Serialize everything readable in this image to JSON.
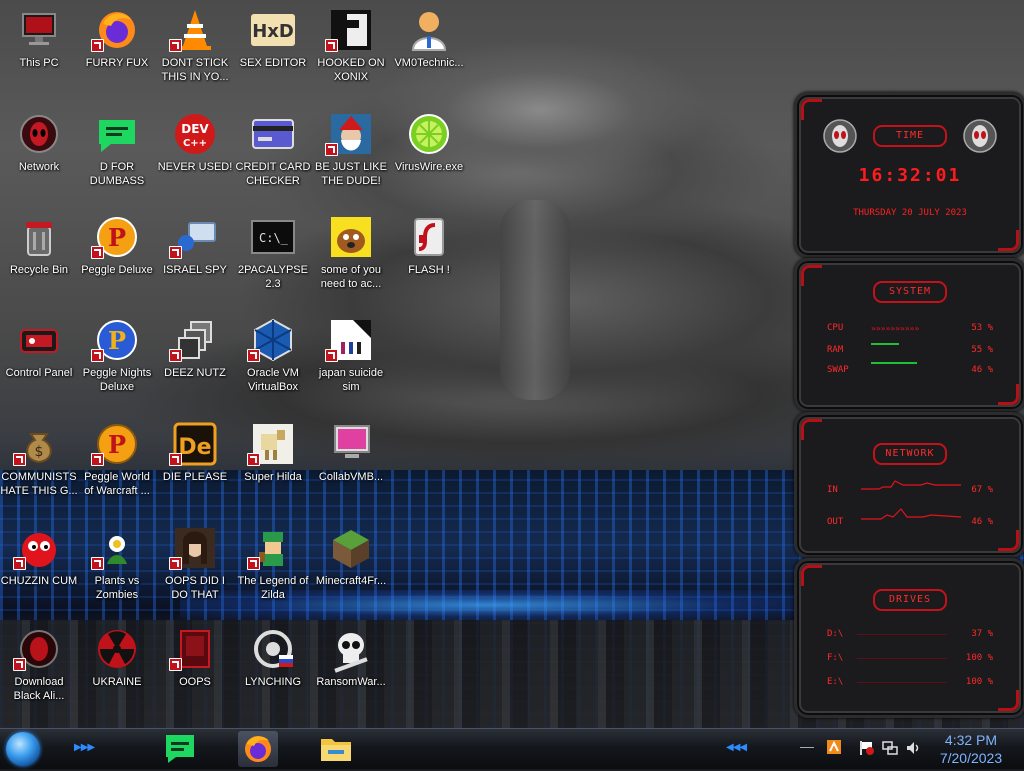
{
  "desktop": {
    "icons": [
      {
        "label": "This PC"
      },
      {
        "label": "FURRY FUX"
      },
      {
        "label": "DONT STICK THIS IN YO..."
      },
      {
        "label": "SEX EDITOR"
      },
      {
        "label": "HOOKED ON XONIX"
      },
      {
        "label": "VM0Technic..."
      },
      {
        "label": "Network"
      },
      {
        "label": "D FOR DUMBASS"
      },
      {
        "label": "NEVER USED!"
      },
      {
        "label": "CREDIT CARD CHECKER"
      },
      {
        "label": "BE JUST LIKE THE DUDE!"
      },
      {
        "label": "VirusWire.exe"
      },
      {
        "label": "Recycle Bin"
      },
      {
        "label": "Peggle Deluxe"
      },
      {
        "label": "ISRAEL SPY"
      },
      {
        "label": "2PACALYPSE 2.3"
      },
      {
        "label": "some of you need to ac..."
      },
      {
        "label": "FLASH !"
      },
      {
        "label": "Control Panel"
      },
      {
        "label": "Peggle Nights Deluxe"
      },
      {
        "label": "DEEZ NUTZ"
      },
      {
        "label": "Oracle VM VirtualBox"
      },
      {
        "label": "japan suicide sim"
      },
      {
        "label": "COMMUNISTS HATE THIS G..."
      },
      {
        "label": "Peggle World of Warcraft ..."
      },
      {
        "label": "DIE PLEASE"
      },
      {
        "label": "Super Hilda"
      },
      {
        "label": "CollabVMB..."
      },
      {
        "label": "CHUZZIN CUM"
      },
      {
        "label": "Plants vs Zombies"
      },
      {
        "label": "OOPS DID I DO THAT"
      },
      {
        "label": "The Legend of Zilda"
      },
      {
        "label": "Minecraft4Fr..."
      },
      {
        "label": "Download Black Ali..."
      },
      {
        "label": "UKRAINE"
      },
      {
        "label": "OOPS"
      },
      {
        "label": "LYNCHING"
      },
      {
        "label": "RansomWar..."
      }
    ]
  },
  "gadget": {
    "time": {
      "title": "TIME",
      "clock": "16:32:01",
      "date": "THURSDAY 20 JULY 2023"
    },
    "system": {
      "title": "SYSTEM",
      "rows": [
        {
          "label": "CPU",
          "value": "53 %",
          "level": 0.53
        },
        {
          "label": "RAM",
          "value": "55 %",
          "level": 0.55
        },
        {
          "label": "SWAP",
          "value": "46 %",
          "level": 0.46
        }
      ]
    },
    "network": {
      "title": "NETWORK",
      "rows": [
        {
          "label": "IN",
          "value": "67 %"
        },
        {
          "label": "OUT",
          "value": "46 %"
        }
      ]
    },
    "drives": {
      "title": "DRIVES",
      "rows": [
        {
          "label": "D:\\",
          "value": "37 %",
          "level": 0.37
        },
        {
          "label": "F:\\",
          "value": "100 %",
          "level": 1.0
        },
        {
          "label": "E:\\",
          "value": "100 %",
          "level": 1.0
        }
      ]
    },
    "colors": {
      "accent": "#ff2020",
      "panel": "#1b1b1d"
    }
  },
  "taskbar": {
    "time": "4:32 PM",
    "date": "7/20/2023",
    "pinned": [
      "spotify-style-icon",
      "firefox-icon",
      "file-explorer-icon"
    ]
  }
}
